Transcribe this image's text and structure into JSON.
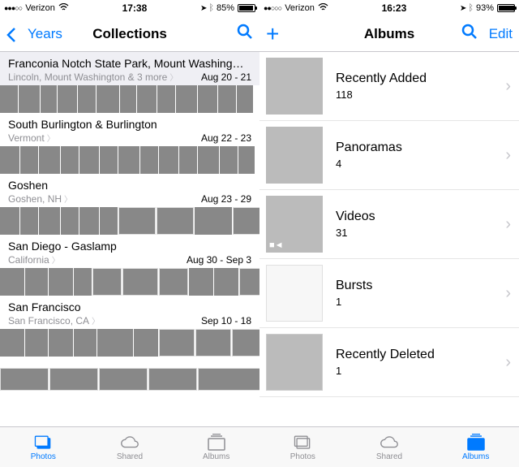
{
  "left": {
    "status": {
      "carrier": "Verizon",
      "time": "17:38",
      "battery": "85%",
      "batFill": 85
    },
    "nav": {
      "back": "Years",
      "title": "Collections"
    },
    "collections": [
      {
        "title": "Franconia Notch State Park, Mount Washing…",
        "subtitle": "Lincoln, Mount Washington & 3 more",
        "date": "Aug 20 - 21"
      },
      {
        "title": "South Burlington & Burlington",
        "subtitle": "Vermont",
        "date": "Aug 22 - 23"
      },
      {
        "title": "Goshen",
        "subtitle": "Goshen, NH",
        "date": "Aug 23 - 29"
      },
      {
        "title": "San Diego - Gaslamp",
        "subtitle": "California",
        "date": "Aug 30 - Sep 3"
      },
      {
        "title": "San Francisco",
        "subtitle": "San Francisco, CA",
        "date": "Sep 10 - 18"
      }
    ],
    "tabs": {
      "photos": "Photos",
      "shared": "Shared",
      "albums": "Albums"
    }
  },
  "right": {
    "status": {
      "carrier": "Verizon",
      "time": "16:23",
      "battery": "93%",
      "batFill": 93
    },
    "nav": {
      "title": "Albums",
      "edit": "Edit"
    },
    "albums": [
      {
        "name": "Recently Added",
        "count": "118"
      },
      {
        "name": "Panoramas",
        "count": "4"
      },
      {
        "name": "Videos",
        "count": "31"
      },
      {
        "name": "Bursts",
        "count": "1"
      },
      {
        "name": "Recently Deleted",
        "count": "1"
      }
    ],
    "tabs": {
      "photos": "Photos",
      "shared": "Shared",
      "albums": "Albums"
    }
  }
}
